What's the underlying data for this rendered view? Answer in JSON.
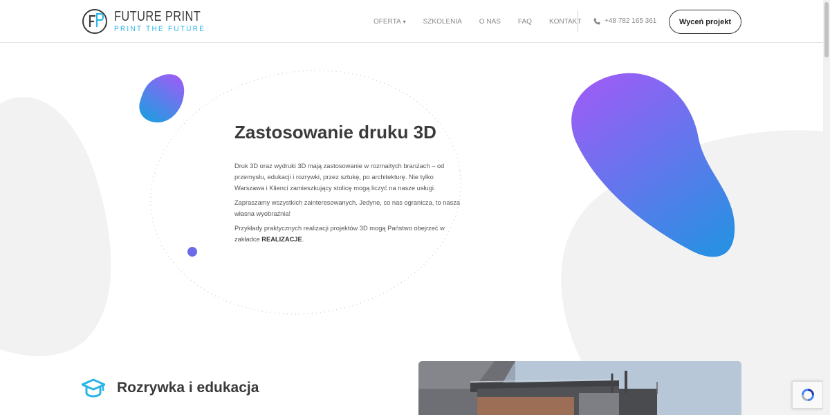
{
  "header": {
    "logo": {
      "title": "FUTURE PRINT",
      "subtitle": "PRINT THE FUTURE"
    },
    "nav": [
      {
        "label": "OFERTA",
        "has_dropdown": true
      },
      {
        "label": "SZKOLENIA"
      },
      {
        "label": "O NAS"
      },
      {
        "label": "FAQ"
      },
      {
        "label": "KONTAKT"
      }
    ],
    "phone": "+48 782 165 361",
    "cta_label": "Wyceń projekt"
  },
  "hero": {
    "title": "Zastosowanie druku 3D",
    "paragraph_1": "Druk 3D oraz wydruki 3D mają zastosowanie w rozmaitych branżach – od przemysłu, edukacji i rozrywki, przez sztukę, po architekturę. Nie tylko Warszawa i Klienci zamieszkujący stolicę mogą liczyć na nasze usługi.",
    "paragraph_2": "Zapraszamy wszystkich zainteresowanych. Jedyne, co nas ogranicza, to nasza własna wyobraźnia!",
    "paragraph_3_before": "Przykłady praktycznych realizacji projektów 3D mogą Państwo obejrzeć w zakładce ",
    "paragraph_3_link": "REALIZACJE",
    "paragraph_3_after": "."
  },
  "section": {
    "title": "Rozrywka i edukacja"
  },
  "colors": {
    "accent_blue": "#2bb4e8",
    "gradient_purple": "#9b5ff5",
    "gradient_blue": "#2f8fe0",
    "background_blob": "#f2f2f2"
  },
  "icons": {
    "phone": "phone-icon",
    "section": "graduation-cap-icon",
    "dropdown": "chevron-down-icon",
    "captcha": "recaptcha-icon"
  }
}
